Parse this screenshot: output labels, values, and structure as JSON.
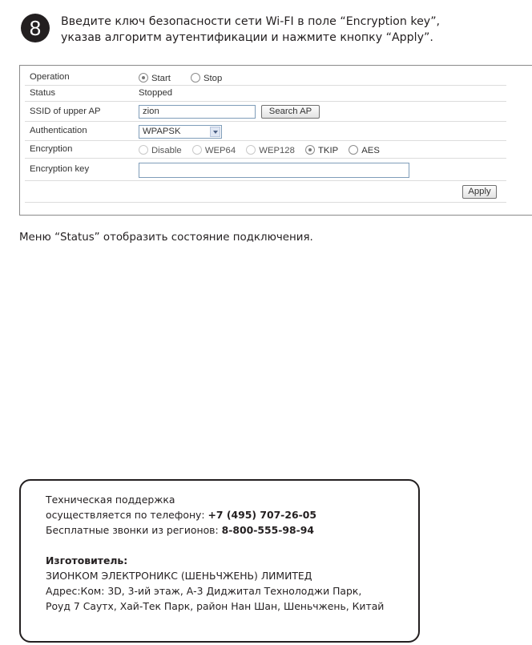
{
  "step": {
    "number": "8",
    "line1": "Введите ключ безопасности сети Wi-FI в поле “Encryption key”,",
    "line2": "указав алгоритм аутентификации и нажмите кнопку “Apply”."
  },
  "form": {
    "operation": {
      "label": "Operation",
      "options": [
        "Start",
        "Stop"
      ],
      "selected": "Start"
    },
    "status": {
      "label": "Status",
      "value": "Stopped"
    },
    "ssid": {
      "label": "SSID of upper AP",
      "value": "zion",
      "button": "Search AP"
    },
    "authentication": {
      "label": "Authentication",
      "value": "WPAPSK"
    },
    "encryption": {
      "label": "Encryption",
      "options": [
        "Disable",
        "WEP64",
        "WEP128",
        "TKIP",
        "AES"
      ],
      "selected": "TKIP"
    },
    "encryption_key": {
      "label": "Encryption key",
      "value": ""
    },
    "apply_button": "Apply"
  },
  "caption": "Меню “Status” отобразить состояние подключения.",
  "support": {
    "line1": "Техническая поддержка",
    "line2_prefix": "осуществляется по телефону: ",
    "phone": "+7 (495) 707-26-05",
    "line3_prefix": "Бесплатные звонки из регионов: ",
    "free_phone": "8-800-555-98-94",
    "manufacturer_title": "Изготовитель:",
    "manufacturer_name": "ЗИОНКОМ ЭЛЕКТРОНИКС (ШЕНЬЧЖЕНЬ) ЛИМИТЕД",
    "address1": "Адрес:Ком: 3D, 3-ий этаж, А-3 Диджитал Технолоджи Парк,",
    "address2": "Роуд 7 Саутх, Хай-Тек Парк, район Нан Шан, Шеньчжень, Китай"
  }
}
